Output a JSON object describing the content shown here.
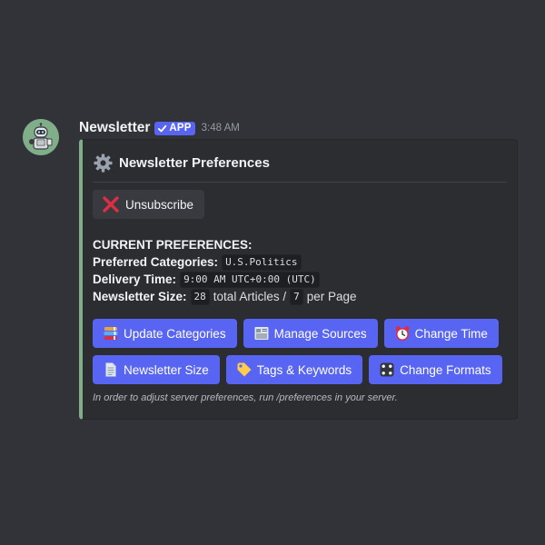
{
  "message": {
    "username": "Newsletter",
    "badge": "APP",
    "timestamp": "3:48 AM",
    "avatar_icon": "robot-avatar-icon"
  },
  "embed": {
    "accent_color": "#7fae88",
    "title": "Newsletter Preferences",
    "title_icon": "gear-icon",
    "unsubscribe_label": "Unsubscribe",
    "unsubscribe_icon": "red-x-icon",
    "preferences": {
      "heading": "CURRENT PREFERENCES:",
      "categories_label": "Preferred Categories:",
      "categories_value": "U.S.Politics",
      "delivery_label": "Delivery Time:",
      "delivery_value": "9:00 AM UTC+0:00 (UTC)",
      "size_label": "Newsletter Size:",
      "size_articles": "28",
      "size_articles_text": "total Articles /",
      "size_per_page": "7",
      "size_per_page_text": "per Page"
    },
    "buttons": [
      {
        "label": "Update Categories",
        "icon": "books-icon"
      },
      {
        "label": "Manage Sources",
        "icon": "newspaper-icon"
      },
      {
        "label": "Change Time",
        "icon": "alarm-clock-icon"
      },
      {
        "label": "Newsletter Size",
        "icon": "page-icon"
      },
      {
        "label": "Tags & Keywords",
        "icon": "tag-icon"
      },
      {
        "label": "Change Formats",
        "icon": "dice-icon"
      }
    ],
    "footer": "In order to adjust server preferences, run /preferences in your server."
  },
  "colors": {
    "background": "#313338",
    "embed_background": "#2b2d31",
    "blurple": "#5865f2",
    "secondary_button": "#383a40"
  }
}
